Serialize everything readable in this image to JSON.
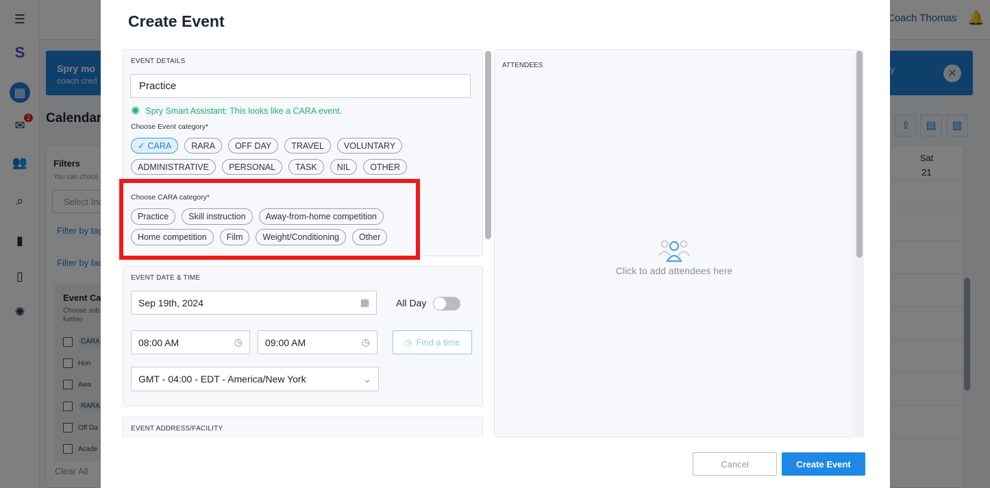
{
  "background": {
    "coach_name": "Coach Thomas",
    "mail_badge": "2",
    "banner": {
      "title": "Spry mo",
      "subtitle": "coach cred",
      "tail": "ry"
    },
    "calendar_title": "Calendar",
    "filters": {
      "title": "Filters",
      "subtitle": "You can choos",
      "select_placeholder": "Select Inc",
      "filter_by_tag": "Filter by tag",
      "filter_by_fac": "Filter by fac",
      "event_cat_title": "Event Cat",
      "event_cat_sub": "Choose sub further",
      "rows": [
        "CARA",
        "Hon",
        "Awa",
        "RARA",
        "Off Da",
        "Acade"
      ],
      "clear_all": "Clear All"
    },
    "day_header": {
      "day": "Sat",
      "date": "21"
    }
  },
  "modal": {
    "title": "Create Event",
    "event_details": {
      "label": "EVENT DETAILS",
      "title_value": "Practice",
      "assistant": "Spry Smart Assistant: This looks like a CARA event.",
      "choose_category_label": "Choose Event category*",
      "categories_row1": [
        "CARA",
        "RARA",
        "OFF DAY",
        "TRAVEL",
        "VOLUNTARY"
      ],
      "categories_row2": [
        "ADMINISTRATIVE",
        "PERSONAL",
        "TASK",
        "NIL",
        "OTHER"
      ],
      "selected_category": "CARA",
      "choose_cara_label": "Choose CARA category*",
      "cara_row1": [
        "Practice",
        "Skill instruction",
        "Away-from-home competition"
      ],
      "cara_row2": [
        "Home competition",
        "Film",
        "Weight/Conditioning",
        "Other"
      ]
    },
    "date_time": {
      "label": "EVENT DATE & TIME",
      "date": "Sep 19th, 2024",
      "all_day_label": "All Day",
      "all_day_on": false,
      "start_time": "08:00 AM",
      "end_time": "09:00 AM",
      "find_time": "Find a time",
      "timezone": "GMT - 04:00 - EDT - America/New York"
    },
    "address": {
      "label": "EVENT ADDRESS/FACILITY"
    },
    "attendees": {
      "label": "ATTENDEES",
      "hint": "Click to add attendees here"
    },
    "buttons": {
      "cancel": "Cancel",
      "create": "Create Event"
    }
  },
  "colors": {
    "primary": "#1e88e5",
    "assistant_green": "#1ab46e",
    "highlight_red": "#f01a1a"
  }
}
